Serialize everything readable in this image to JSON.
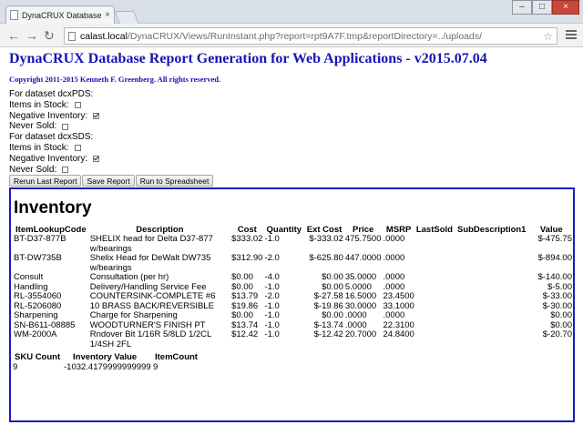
{
  "browser": {
    "tab_title": "DynaCRUX Database Repo",
    "tab_close": "×",
    "url_host": "calast.local",
    "url_path": "/DynaCRUX/Views/RunInstant.php?report=rpt9A7F.tmp&reportDirectory=../uploads/",
    "win_min": "–",
    "win_max": "□",
    "win_close": "×",
    "back": "←",
    "forward": "→",
    "reload": "↻",
    "star": "☆"
  },
  "header": {
    "title": "DynaCRUX Database Report Generation for Web Applications - v2015.07.04",
    "copyright": "Copyright 2011-2015 Kenneth F. Greenberg. All rights reserved."
  },
  "options": [
    {
      "type": "label",
      "text": "For dataset dcxPDS:"
    },
    {
      "type": "check",
      "text": "Items in Stock:",
      "checked": false
    },
    {
      "type": "check",
      "text": "Negative Inventory:",
      "checked": true
    },
    {
      "type": "check",
      "text": "Never Sold:",
      "checked": false
    },
    {
      "type": "label",
      "text": "For dataset dcxSDS:"
    },
    {
      "type": "check",
      "text": "Items in Stock:",
      "checked": false
    },
    {
      "type": "check",
      "text": "Negative Inventory:",
      "checked": true
    },
    {
      "type": "check",
      "text": "Never Sold:",
      "checked": false
    }
  ],
  "buttons": {
    "rerun": "Rerun Last Report",
    "save": "Save Report",
    "spreadsheet": "Run to Spreadsheet"
  },
  "report": {
    "title": "Inventory",
    "columns": [
      "ItemLookupCode",
      "Description",
      "Cost",
      "Quantity",
      "Ext Cost",
      "Price",
      "MSRP",
      "LastSold",
      "SubDescription1",
      "Value"
    ],
    "rows": [
      [
        "BT-D37-877B",
        "SHELIX head for Delta D37-877 w/bearings",
        "$333.02",
        "-1.0",
        "$-333.02",
        "475.7500",
        ".0000",
        "",
        "",
        "$-475.75"
      ],
      [
        "BT-DW735B",
        "Shelix Head for DeWalt DW735 w/bearings",
        "$312.90",
        "-2.0",
        "$-625.80",
        "447.0000",
        ".0000",
        "",
        "",
        "$-894.00"
      ],
      [
        "Consult",
        "Consultation (per hr)",
        "$0.00",
        "-4.0",
        "$0.00",
        "35.0000",
        ".0000",
        "",
        "",
        "$-140.00"
      ],
      [
        "Handling",
        "Delivery/Handling Service Fee",
        "$0.00",
        "-1.0",
        "$0.00",
        "5.0000",
        ".0000",
        "",
        "",
        "$-5.00"
      ],
      [
        "RL-3554060",
        "COUNTERSINK-COMPLETE #6",
        "$13.79",
        "-2.0",
        "$-27.58",
        "16.5000",
        "23.4500",
        "",
        "",
        "$-33.00"
      ],
      [
        "RL-5206080",
        "10 BRASS BACK/REVERSIBLE",
        "$19.86",
        "-1.0",
        "$-19.86",
        "30.0000",
        "33.1000",
        "",
        "",
        "$-30.00"
      ],
      [
        "Sharpening",
        "Charge for Sharpening",
        "$0.00",
        "-1.0",
        "$0.00",
        ".0000",
        ".0000",
        "",
        "",
        "$0.00"
      ],
      [
        "SN-B611-08885",
        "WOODTURNER'S FINISH PT",
        "$13.74",
        "-1.0",
        "$-13.74",
        ".0000",
        "22.3100",
        "",
        "",
        "$0.00"
      ],
      [
        "WM-2000A",
        "Rndover Bit 1/16R 5/8LD 1/2CL 1/4SH 2FL",
        "$12.42",
        "-1.0",
        "$-12.42",
        "20.7000",
        "24.8400",
        "",
        "",
        "$-20.70"
      ]
    ],
    "summary_labels": [
      "SKU Count",
      "Inventory Value",
      "ItemCount"
    ],
    "summary_values": [
      "9",
      "-1032.4179999999999",
      "9"
    ]
  }
}
